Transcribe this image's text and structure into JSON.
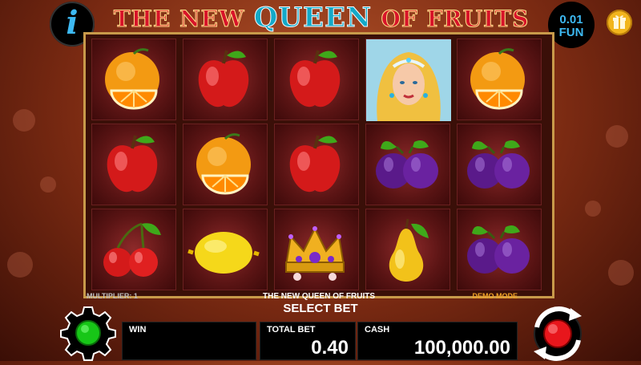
{
  "header": {
    "title_part1": "THE NEW",
    "title_part2": "QUEEN",
    "title_part3": "OF FRUITS",
    "info_icon": "i",
    "credit_value": "0.01",
    "credit_mode": "FUN",
    "gift_icon": "gift-icon"
  },
  "reels": {
    "rows": [
      [
        "orange",
        "apple",
        "apple",
        "queen",
        "orange"
      ],
      [
        "apple",
        "orange",
        "apple",
        "plum",
        "plum"
      ],
      [
        "cherry",
        "lemon",
        "crown",
        "pear",
        "plum"
      ]
    ]
  },
  "info_bar": {
    "multiplier": "MULTIPLIER: 1",
    "game_name": "THE NEW QUEEN OF FRUITS",
    "mode": "DEMO MODE"
  },
  "controls": {
    "select_bet": "SELECT BET",
    "win_label": "WIN",
    "win_value": "",
    "total_bet_label": "TOTAL BET",
    "total_bet_value": "0.40",
    "cash_label": "CASH",
    "cash_value": "100,000.00"
  },
  "colors": {
    "accent_blue": "#3db9f2",
    "demo_orange": "#f2a428",
    "spin_red": "#e8161c",
    "settings_green": "#17c617"
  }
}
